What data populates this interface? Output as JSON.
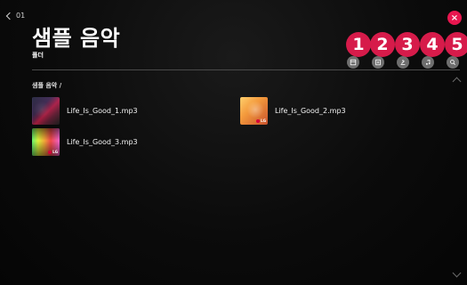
{
  "header": {
    "back_label": "01",
    "title": "샘플 음악",
    "subtitle": "폴더",
    "close_label": "×"
  },
  "badges": [
    "1",
    "2",
    "3",
    "4",
    "5"
  ],
  "toolbar": {
    "icons": [
      "view-icon",
      "sort-icon",
      "person-icon",
      "music-icon",
      "search-icon"
    ],
    "colors": {
      "tool_bg": "#6e6e6e",
      "badge_bg": "#d61b4a",
      "close_bg": "#e8164f"
    }
  },
  "breadcrumb": "샘플 음악 /",
  "files": [
    {
      "name": "Life_Is_Good_1.mp3",
      "thumb": "purple-pink-abstract"
    },
    {
      "name": "Life_Is_Good_2.mp3",
      "thumb": "orange-warm-abstract"
    },
    {
      "name": "Life_Is_Good_3.mp3",
      "thumb": "rainbow-spectrum"
    }
  ],
  "thumb_logo": "LG"
}
